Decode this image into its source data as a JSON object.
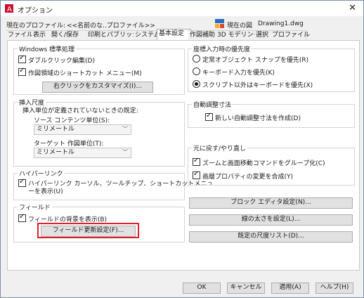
{
  "window": {
    "title": "オプション",
    "close_glyph": "✕"
  },
  "profile": {
    "label": "現在のプロファイル:",
    "value": "<<名前のな..プロファイル>>",
    "drawing_label": "現在の図",
    "drawing_value": "Drawing1.dwg"
  },
  "tabs": [
    "ファイル",
    "表示",
    "開く/保存",
    "印刷とパブリッシュ",
    "システム",
    "基本設定",
    "作図補助",
    "3D モデリング",
    "選択",
    "プロファイル"
  ],
  "windows_group": {
    "title": "Windows 標準処理",
    "dblclick": "ダブルクリック編集(D)",
    "shortcut_menu": "作図領域のショートカット メニュー(M)",
    "customize_right_click": "右クリックをカスタマイズ(I)..."
  },
  "insert_scale": {
    "title": "挿入尺度",
    "desc": "挿入単位が定義されていないときの既定:",
    "source_label": "ソース コンテンツ単位(S):",
    "source_value": "ミリメートル",
    "target_label": "ターゲット 作図単位(T):",
    "target_value": "ミリメートル"
  },
  "hyperlink": {
    "title": "ハイパーリンク",
    "option_line1": "ハイパーリンク カーソル、ツールチップ、ショートカットメニュ",
    "option_line2": "ーを表示(U)"
  },
  "fields": {
    "title": "フィールド",
    "show_bg": "フィールドの背景を表示(B)",
    "update_settings": "フィールド更新設定(F)..."
  },
  "coord_priority": {
    "title": "座標入力時の優先度",
    "opt1": "定常オブジェクト スナップを優先(R)",
    "opt2": "キーボード入力を優先(K)",
    "opt3": "スクリプト以外はキーボードを優先(X)",
    "selected": 3
  },
  "auto_dim": {
    "title": "自動調整寸法",
    "new_assoc": "新しい自動調整寸法を作成(D)"
  },
  "undo_redo": {
    "title": "元に戻す/やり直し",
    "zoom_pan": "ズームと画面移動コマンドをグループ化(C)",
    "layer_prop": "画層プロパティの変更を合成(Y)"
  },
  "right_buttons": {
    "block_editor": "ブロック エディタ設定(N)...",
    "lineweight": "線の太さを設定(L)...",
    "scale_list": "既定の尺度リスト(D)..."
  },
  "footer": {
    "ok": "OK",
    "cancel": "キャンセル",
    "apply": "適用(A)",
    "help": "ヘルプ(H)"
  },
  "colors": {
    "highlight": "#e0202c",
    "accent": "#2b6cc4"
  },
  "icons": [
    "app-icon",
    "close-icon",
    "drawing-file-icon",
    "checkbox-checked-icon",
    "radio-icon",
    "chevron-down-icon"
  ]
}
